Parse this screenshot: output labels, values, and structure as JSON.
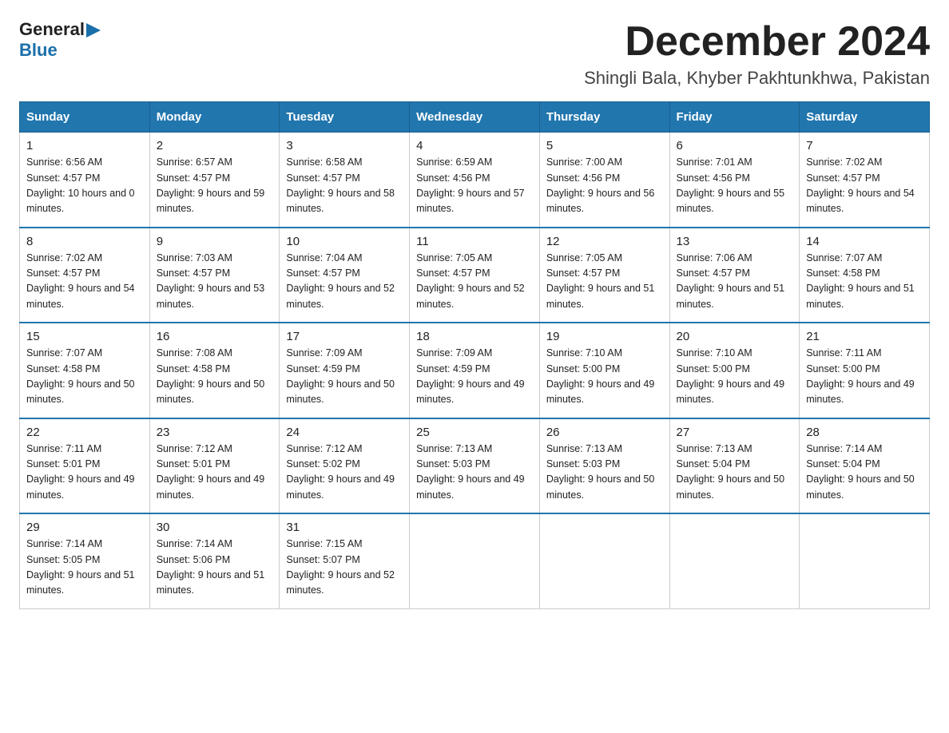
{
  "logo": {
    "general": "General",
    "arrow": "▶",
    "blue": "Blue"
  },
  "title": "December 2024",
  "location": "Shingli Bala, Khyber Pakhtunkhwa, Pakistan",
  "days_of_week": [
    "Sunday",
    "Monday",
    "Tuesday",
    "Wednesday",
    "Thursday",
    "Friday",
    "Saturday"
  ],
  "weeks": [
    [
      {
        "day": "1",
        "sunrise": "6:56 AM",
        "sunset": "4:57 PM",
        "daylight": "10 hours and 0 minutes."
      },
      {
        "day": "2",
        "sunrise": "6:57 AM",
        "sunset": "4:57 PM",
        "daylight": "9 hours and 59 minutes."
      },
      {
        "day": "3",
        "sunrise": "6:58 AM",
        "sunset": "4:57 PM",
        "daylight": "9 hours and 58 minutes."
      },
      {
        "day": "4",
        "sunrise": "6:59 AM",
        "sunset": "4:56 PM",
        "daylight": "9 hours and 57 minutes."
      },
      {
        "day": "5",
        "sunrise": "7:00 AM",
        "sunset": "4:56 PM",
        "daylight": "9 hours and 56 minutes."
      },
      {
        "day": "6",
        "sunrise": "7:01 AM",
        "sunset": "4:56 PM",
        "daylight": "9 hours and 55 minutes."
      },
      {
        "day": "7",
        "sunrise": "7:02 AM",
        "sunset": "4:57 PM",
        "daylight": "9 hours and 54 minutes."
      }
    ],
    [
      {
        "day": "8",
        "sunrise": "7:02 AM",
        "sunset": "4:57 PM",
        "daylight": "9 hours and 54 minutes."
      },
      {
        "day": "9",
        "sunrise": "7:03 AM",
        "sunset": "4:57 PM",
        "daylight": "9 hours and 53 minutes."
      },
      {
        "day": "10",
        "sunrise": "7:04 AM",
        "sunset": "4:57 PM",
        "daylight": "9 hours and 52 minutes."
      },
      {
        "day": "11",
        "sunrise": "7:05 AM",
        "sunset": "4:57 PM",
        "daylight": "9 hours and 52 minutes."
      },
      {
        "day": "12",
        "sunrise": "7:05 AM",
        "sunset": "4:57 PM",
        "daylight": "9 hours and 51 minutes."
      },
      {
        "day": "13",
        "sunrise": "7:06 AM",
        "sunset": "4:57 PM",
        "daylight": "9 hours and 51 minutes."
      },
      {
        "day": "14",
        "sunrise": "7:07 AM",
        "sunset": "4:58 PM",
        "daylight": "9 hours and 51 minutes."
      }
    ],
    [
      {
        "day": "15",
        "sunrise": "7:07 AM",
        "sunset": "4:58 PM",
        "daylight": "9 hours and 50 minutes."
      },
      {
        "day": "16",
        "sunrise": "7:08 AM",
        "sunset": "4:58 PM",
        "daylight": "9 hours and 50 minutes."
      },
      {
        "day": "17",
        "sunrise": "7:09 AM",
        "sunset": "4:59 PM",
        "daylight": "9 hours and 50 minutes."
      },
      {
        "day": "18",
        "sunrise": "7:09 AM",
        "sunset": "4:59 PM",
        "daylight": "9 hours and 49 minutes."
      },
      {
        "day": "19",
        "sunrise": "7:10 AM",
        "sunset": "5:00 PM",
        "daylight": "9 hours and 49 minutes."
      },
      {
        "day": "20",
        "sunrise": "7:10 AM",
        "sunset": "5:00 PM",
        "daylight": "9 hours and 49 minutes."
      },
      {
        "day": "21",
        "sunrise": "7:11 AM",
        "sunset": "5:00 PM",
        "daylight": "9 hours and 49 minutes."
      }
    ],
    [
      {
        "day": "22",
        "sunrise": "7:11 AM",
        "sunset": "5:01 PM",
        "daylight": "9 hours and 49 minutes."
      },
      {
        "day": "23",
        "sunrise": "7:12 AM",
        "sunset": "5:01 PM",
        "daylight": "9 hours and 49 minutes."
      },
      {
        "day": "24",
        "sunrise": "7:12 AM",
        "sunset": "5:02 PM",
        "daylight": "9 hours and 49 minutes."
      },
      {
        "day": "25",
        "sunrise": "7:13 AM",
        "sunset": "5:03 PM",
        "daylight": "9 hours and 49 minutes."
      },
      {
        "day": "26",
        "sunrise": "7:13 AM",
        "sunset": "5:03 PM",
        "daylight": "9 hours and 50 minutes."
      },
      {
        "day": "27",
        "sunrise": "7:13 AM",
        "sunset": "5:04 PM",
        "daylight": "9 hours and 50 minutes."
      },
      {
        "day": "28",
        "sunrise": "7:14 AM",
        "sunset": "5:04 PM",
        "daylight": "9 hours and 50 minutes."
      }
    ],
    [
      {
        "day": "29",
        "sunrise": "7:14 AM",
        "sunset": "5:05 PM",
        "daylight": "9 hours and 51 minutes."
      },
      {
        "day": "30",
        "sunrise": "7:14 AM",
        "sunset": "5:06 PM",
        "daylight": "9 hours and 51 minutes."
      },
      {
        "day": "31",
        "sunrise": "7:15 AM",
        "sunset": "5:07 PM",
        "daylight": "9 hours and 52 minutes."
      },
      null,
      null,
      null,
      null
    ]
  ]
}
